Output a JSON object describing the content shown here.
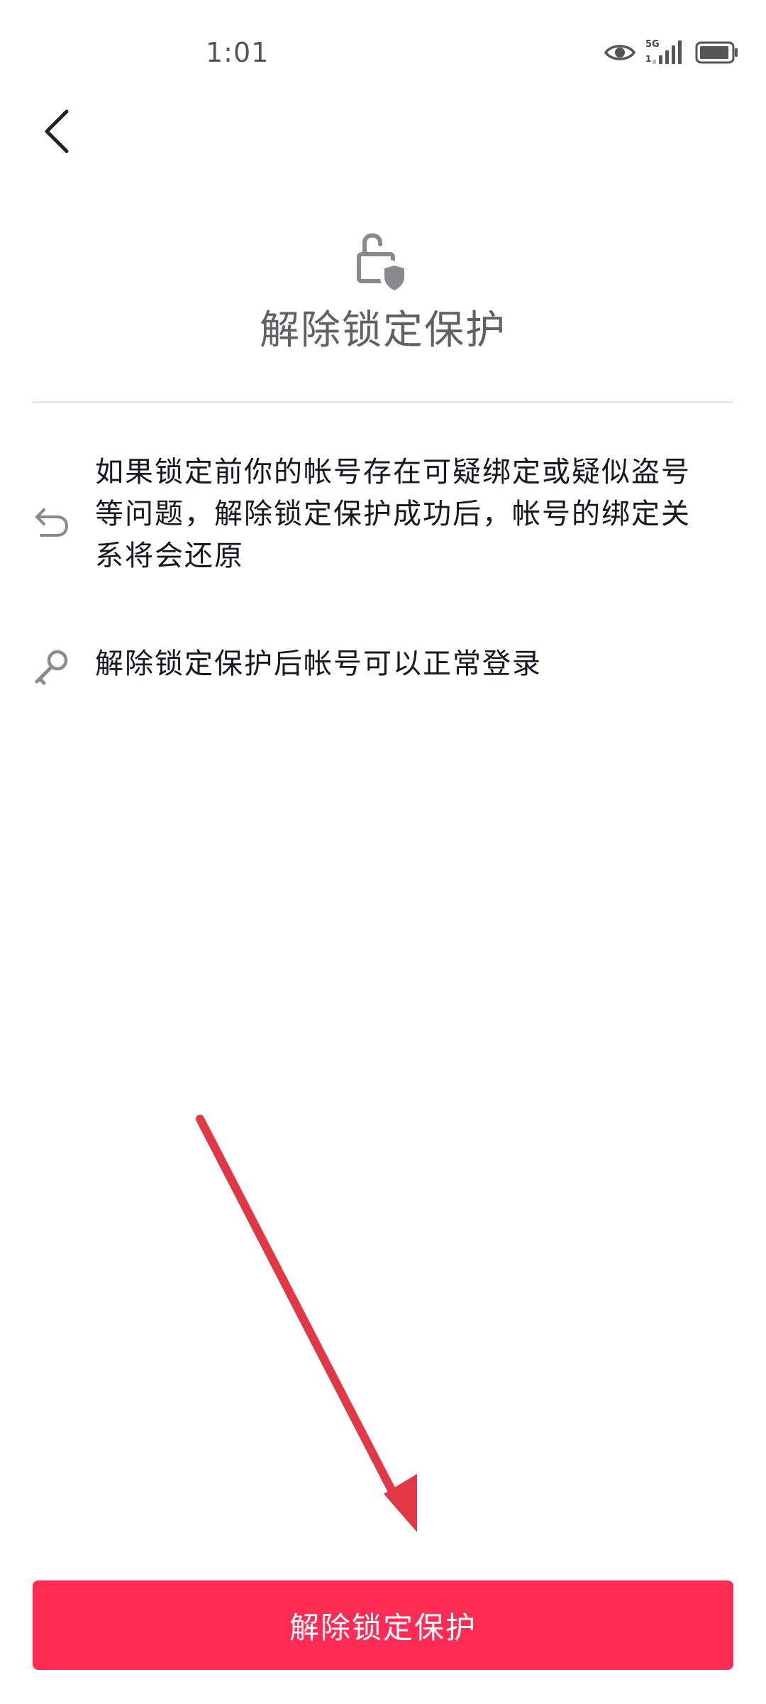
{
  "status_bar": {
    "time": "1:01",
    "network": "5G",
    "icons": [
      "eye-icon",
      "signal-icon",
      "battery-icon"
    ]
  },
  "header": {
    "back_icon": "chevron-left-icon"
  },
  "hero": {
    "icon": "unlock-shield-icon",
    "title": "解除锁定保护"
  },
  "info_items": [
    {
      "icon": "undo-arrow-icon",
      "text": "如果锁定前你的帐号存在可疑绑定或疑似盗号等问题，解除锁定保护成功后，帐号的绑定关系将会还原"
    },
    {
      "icon": "key-icon",
      "text": "解除锁定保护后帐号可以正常登录"
    }
  ],
  "annotation": {
    "icon": "red-arrow-annotation"
  },
  "footer": {
    "button_label": "解除锁定保护"
  },
  "colors": {
    "accent": "#fe2c55",
    "title_gray": "#606066",
    "annotation_red": "#e23744"
  }
}
